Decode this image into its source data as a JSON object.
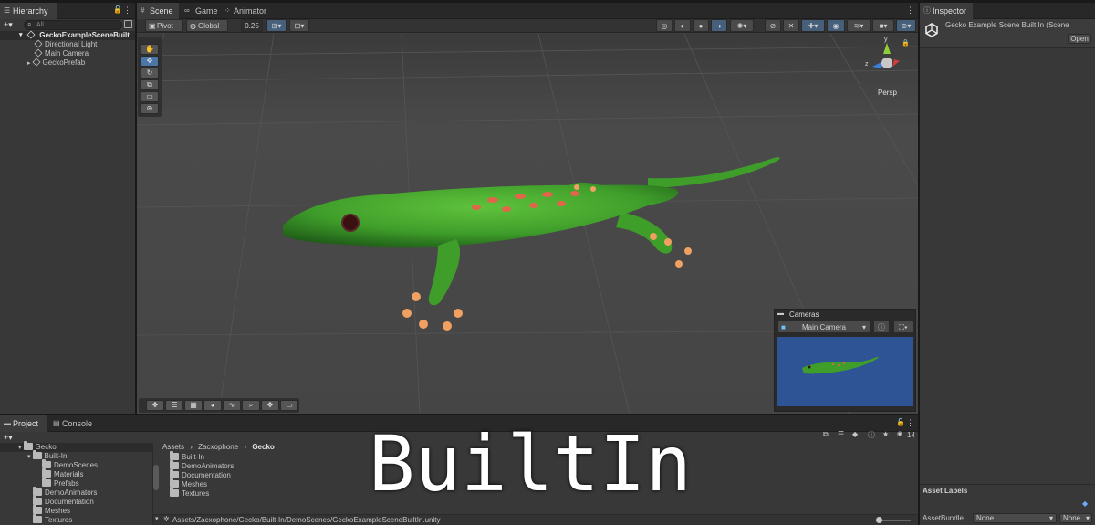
{
  "hierarchy": {
    "tab": "Hierarchy",
    "add_label": "+▾",
    "search_placeholder": "All",
    "scene_root": "GeckoExampleSceneBuilt",
    "items": [
      "Directional Light",
      "Main Camera",
      "GeckoPrefab"
    ]
  },
  "scene_tabs": [
    {
      "label": "Scene",
      "icon": "grid-icon"
    },
    {
      "label": "Game",
      "icon": "gamepad-icon"
    },
    {
      "label": "Animator",
      "icon": "dots-icon"
    }
  ],
  "scene_toolbar": {
    "pivot": "Pivot",
    "global": "Global",
    "snap_value": "0.25",
    "persp": "Persp"
  },
  "cameras_overlay": {
    "title": "Cameras",
    "selected": "Main Camera"
  },
  "inspector": {
    "tab": "Inspector",
    "title": "Gecko Example Scene Built In (Scene",
    "open_label": "Open",
    "asset_labels": "Asset Labels",
    "asset_bundle_label": "AssetBundle",
    "bundle_value": "None",
    "variant_value": "None"
  },
  "project": {
    "tab_project": "Project",
    "tab_console": "Console",
    "add_label": "+▾",
    "tree": [
      {
        "label": "Gecko",
        "level": 0,
        "open": true
      },
      {
        "label": "Built-In",
        "level": 1,
        "open": true
      },
      {
        "label": "DemoScenes",
        "level": 2
      },
      {
        "label": "Materials",
        "level": 2
      },
      {
        "label": "Prefabs",
        "level": 2
      },
      {
        "label": "DemoAnimators",
        "level": 1
      },
      {
        "label": "Documentation",
        "level": 1
      },
      {
        "label": "Meshes",
        "level": 1
      },
      {
        "label": "Textures",
        "level": 1
      }
    ],
    "breadcrumb": [
      "Assets",
      "Zacxophone",
      "Gecko"
    ],
    "contents": [
      "Built-In",
      "DemoAnimators",
      "Documentation",
      "Meshes",
      "Textures"
    ],
    "hidden_count": "14",
    "status_path": "Assets/Zacxophone/Gecko/Built-In/DemoScenes/GeckoExampleSceneBuiltIn.unity"
  },
  "overlay_caption": "BuiltIn",
  "colors": {
    "accent": "#4a76a8",
    "gecko_green": "#3f9e2a",
    "gecko_spots": "#e2654a",
    "camera_preview_bg": "#2f5496"
  }
}
